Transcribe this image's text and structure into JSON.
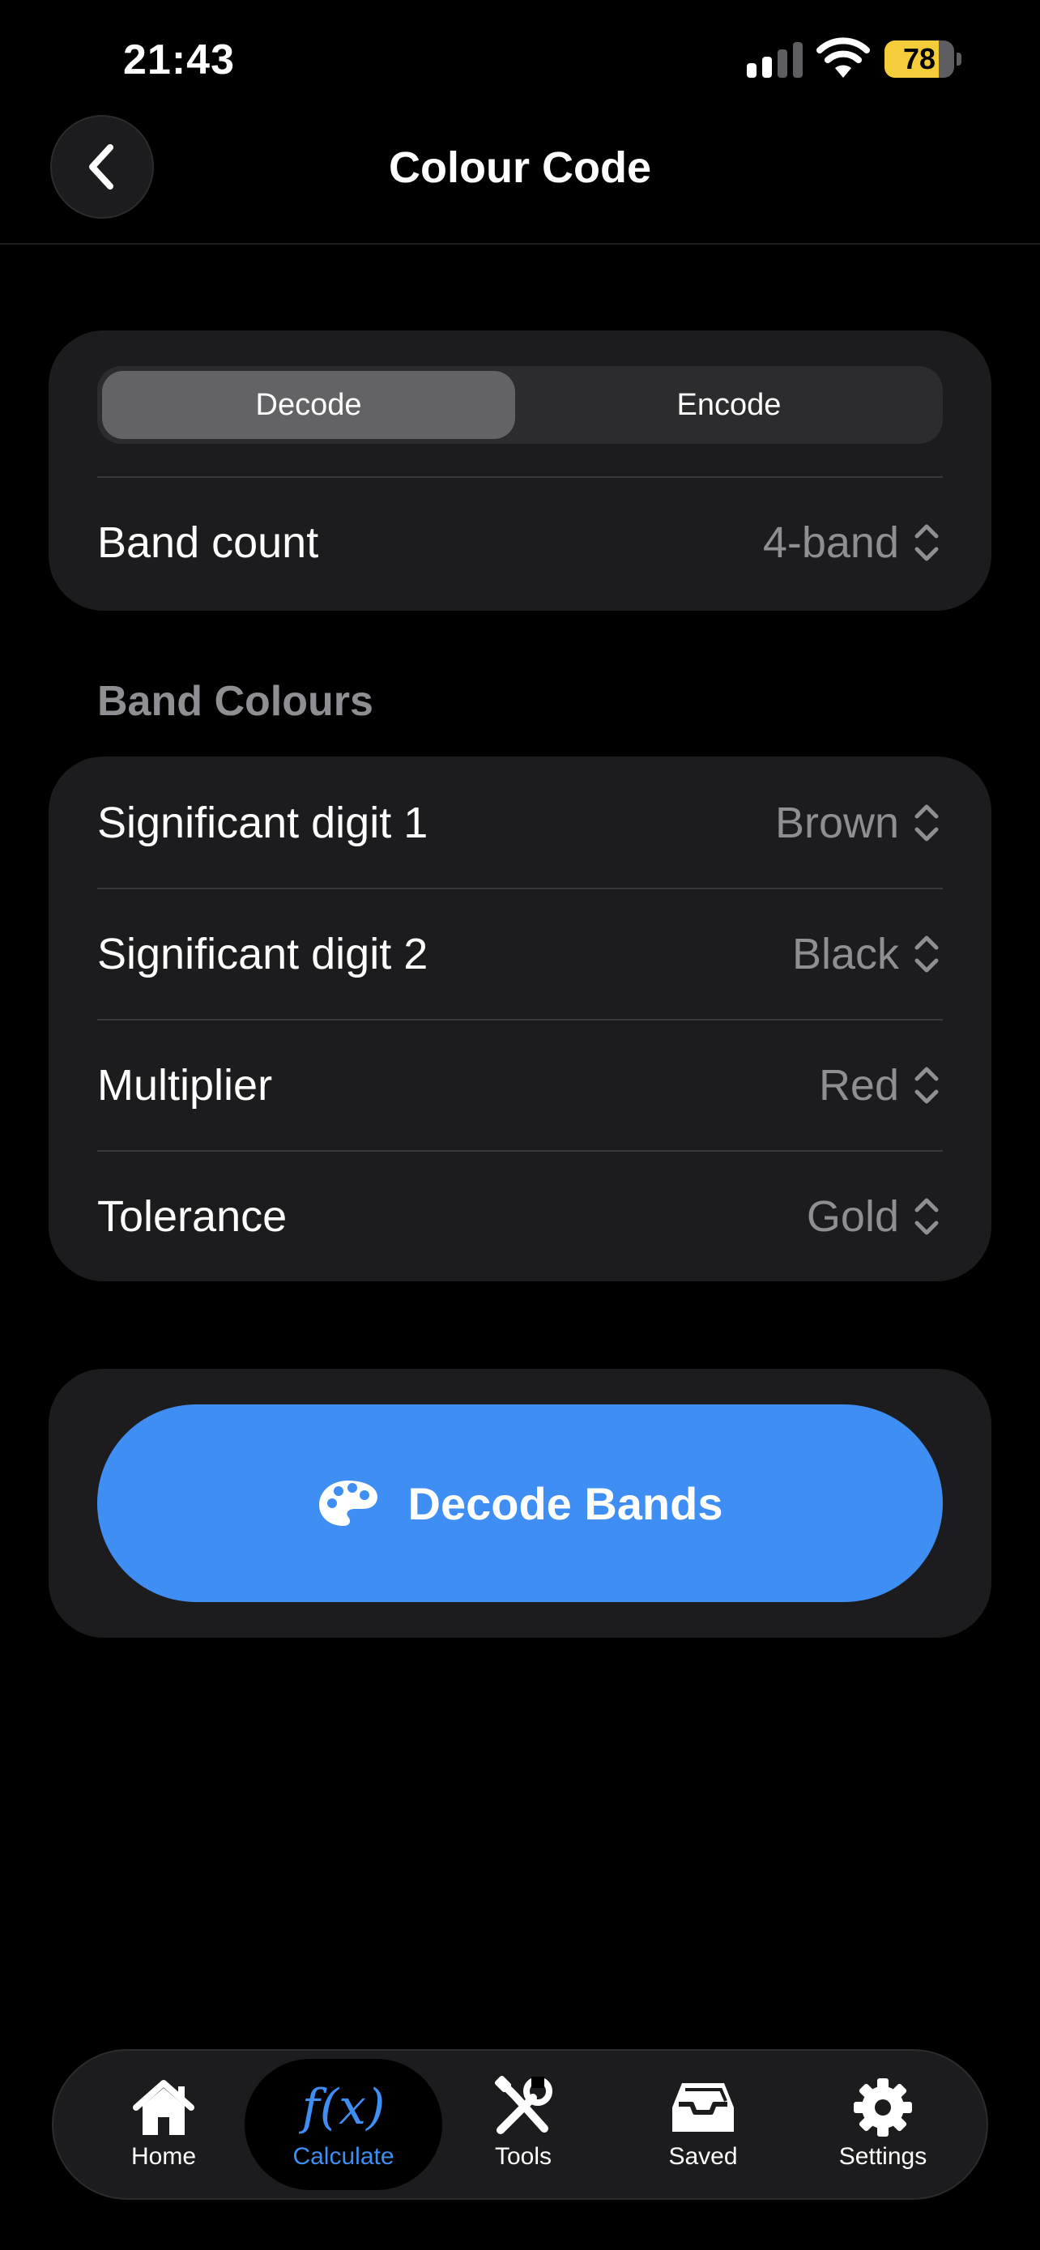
{
  "status_bar": {
    "time": "21:43",
    "battery": 78,
    "battery_color": "#f5cd3a"
  },
  "nav": {
    "title": "Colour Code",
    "back_icon": "chevron-left-icon"
  },
  "mode": {
    "options": [
      "Decode",
      "Encode"
    ],
    "selected": "Decode"
  },
  "band_count": {
    "label": "Band count",
    "value": "4-band"
  },
  "band_colours": {
    "header": "Band Colours",
    "rows": [
      {
        "label": "Significant digit 1",
        "value": "Brown"
      },
      {
        "label": "Significant digit 2",
        "value": "Black"
      },
      {
        "label": "Multiplier",
        "value": "Red"
      },
      {
        "label": "Tolerance",
        "value": "Gold"
      }
    ]
  },
  "action": {
    "label": "Decode Bands",
    "icon": "palette-icon",
    "color": "#3f8ef3"
  },
  "tab_bar": {
    "items": [
      {
        "label": "Home",
        "icon": "house-icon"
      },
      {
        "label": "Calculate",
        "icon": "function-icon",
        "glyph": "f(x)",
        "active": true
      },
      {
        "label": "Tools",
        "icon": "wrench-screwdriver-icon"
      },
      {
        "label": "Saved",
        "icon": "tray-icon"
      },
      {
        "label": "Settings",
        "icon": "gear-icon"
      }
    ]
  }
}
